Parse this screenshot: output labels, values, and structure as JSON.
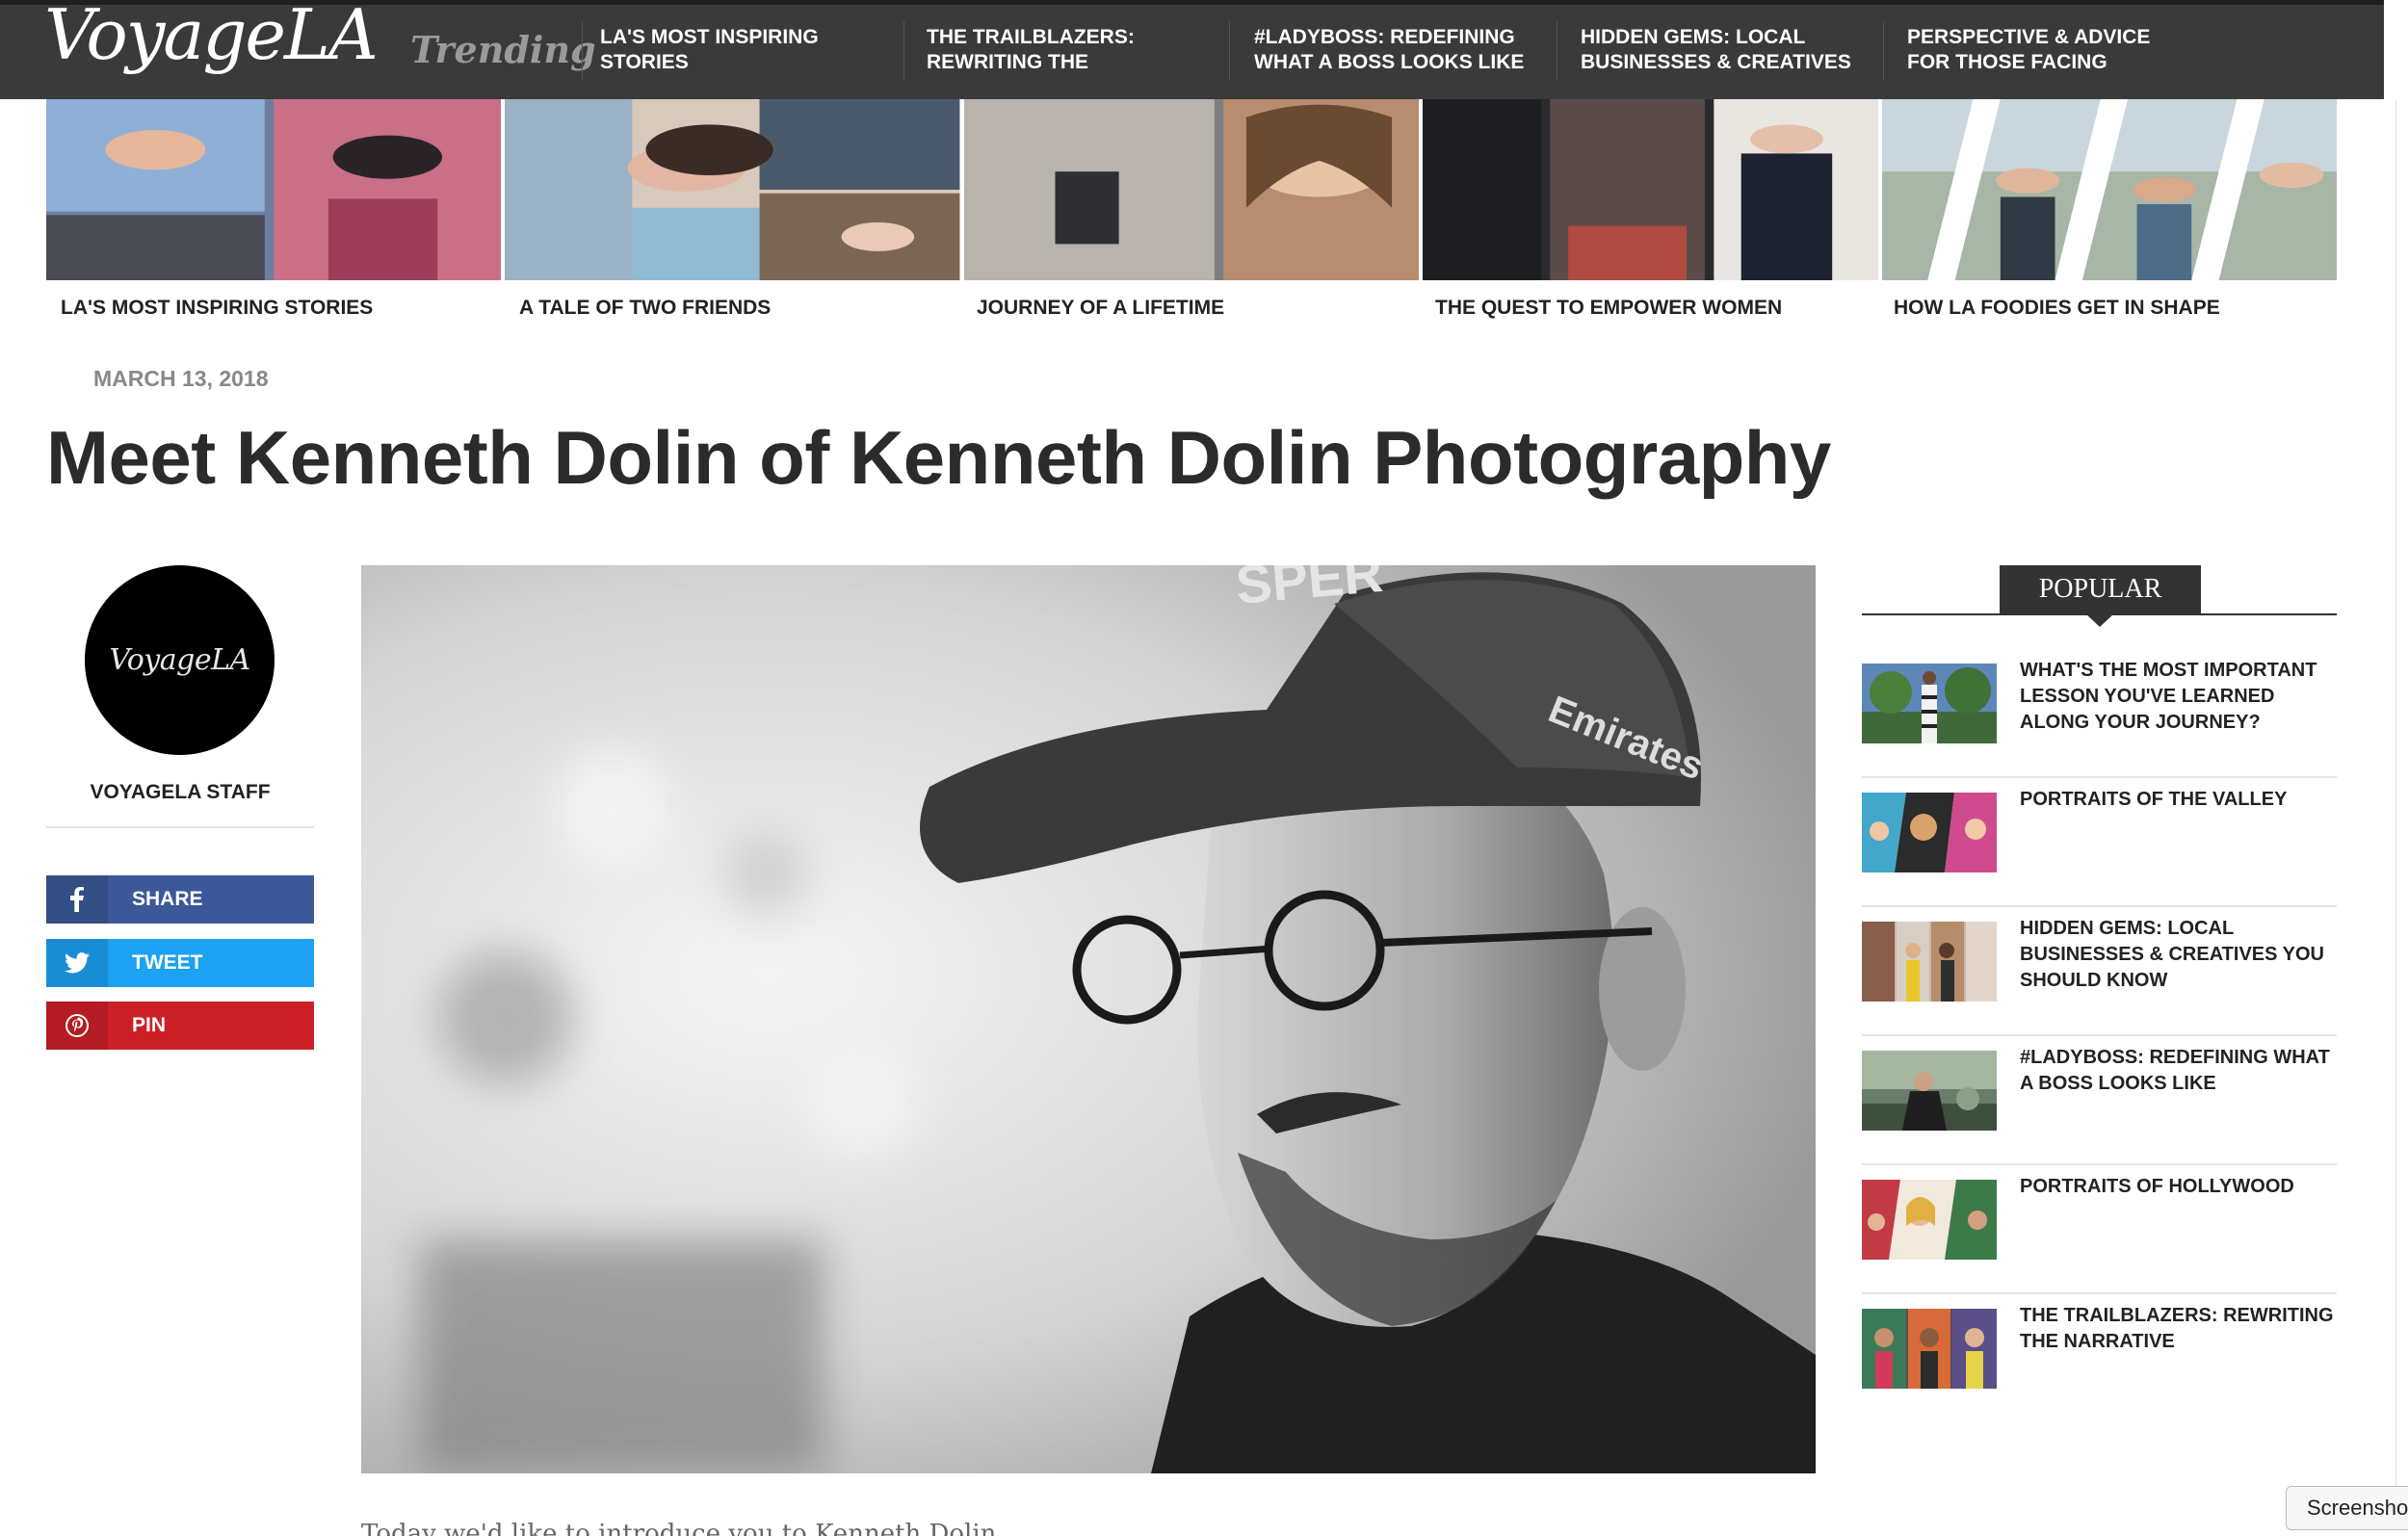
{
  "header": {
    "logo": "VoyageLA",
    "trending_label": "Trending",
    "nav": [
      {
        "label": "LA'S MOST INSPIRING STORIES"
      },
      {
        "label": "THE TRAILBLAZERS: REWRITING THE"
      },
      {
        "label": "#LADYBOSS: REDEFINING WHAT A BOSS LOOKS LIKE"
      },
      {
        "label": "HIDDEN GEMS: LOCAL BUSINESSES & CREATIVES"
      },
      {
        "label": "PERSPECTIVE & ADVICE FOR THOSE FACING"
      }
    ]
  },
  "trending_bar": {
    "captions": [
      "LA'S MOST INSPIRING STORIES",
      "A TALE OF TWO FRIENDS",
      "JOURNEY OF A LIFETIME",
      "THE QUEST TO EMPOWER WOMEN",
      "HOW LA FOODIES GET IN SHAPE"
    ]
  },
  "article": {
    "date": "MARCH 13, 2018",
    "title": "Meet Kenneth Dolin of Kenneth Dolin Photography",
    "intro_text_partial": "Today we'd like to introduce you to Kenneth Dolin."
  },
  "author": {
    "avatar_text": "VoyageLA",
    "name": "VOYAGELA STAFF"
  },
  "share": {
    "buttons": [
      {
        "label": "SHARE",
        "icon": "facebook-icon",
        "color": "#3b5998"
      },
      {
        "label": "TWEET",
        "icon": "twitter-icon",
        "color": "#1da1f2"
      },
      {
        "label": "PIN",
        "icon": "pinterest-icon",
        "color": "#cb2027"
      }
    ]
  },
  "popular": {
    "heading": "POPULAR",
    "items": [
      {
        "title": "WHAT'S THE MOST IMPORTANT LESSON YOU'VE LEARNED ALONG YOUR JOURNEY?"
      },
      {
        "title": "PORTRAITS OF THE VALLEY"
      },
      {
        "title": "HIDDEN GEMS: LOCAL BUSINESSES & CREATIVES YOU SHOULD KNOW"
      },
      {
        "title": "#LADYBOSS: REDEFINING WHAT A BOSS LOOKS LIKE"
      },
      {
        "title": "PORTRAITS OF HOLLYWOOD"
      },
      {
        "title": "THE TRAILBLAZERS: REWRITING THE NARRATIVE"
      }
    ]
  },
  "overlay": {
    "screenshot_button": "Screenshot"
  },
  "colors": {
    "topbar": "#3a3a3a",
    "facebook": "#3b5998",
    "twitter": "#1da1f2",
    "pinterest": "#cb2027"
  }
}
